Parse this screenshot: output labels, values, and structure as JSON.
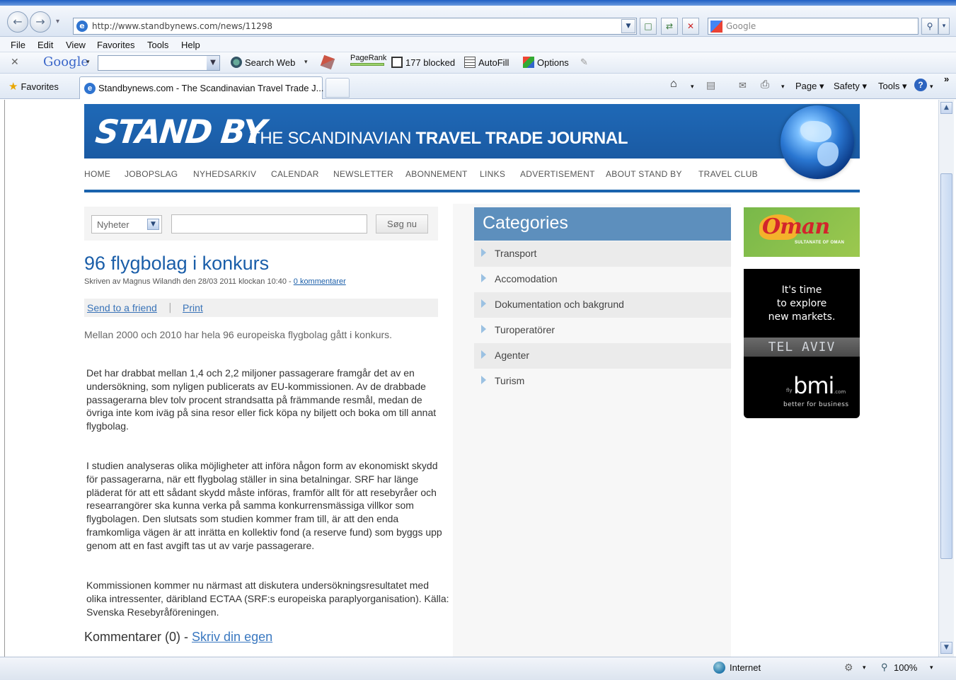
{
  "browser": {
    "url": "http://www.standbynews.com/news/11298",
    "search_placeholder": "Google",
    "menu": [
      "File",
      "Edit",
      "View",
      "Favorites",
      "Tools",
      "Help"
    ],
    "toolbar": {
      "google_logo": "Google",
      "search_web": "Search Web",
      "pagerank": "PageRank",
      "blocked": "177 blocked",
      "autofill": "AutoFill",
      "options": "Options"
    },
    "favorites_label": "Favorites",
    "tab_title": "Standbynews.com - The Scandinavian Travel Trade J...",
    "commands": {
      "page": "Page",
      "safety": "Safety",
      "tools": "Tools"
    },
    "status": {
      "zone": "Internet",
      "zoom": "100%"
    }
  },
  "site": {
    "logo": "STAND BY",
    "tagline_light": "THE SCANDINAVIAN ",
    "tagline_bold": "TRAVEL TRADE JOURNAL",
    "nav": [
      "HOME",
      "JOBOPSLAG",
      "NYHEDSARKIV",
      "CALENDAR",
      "NEWSLETTER",
      "ABONNEMENT",
      "LINKS",
      "ADVERTISEMENT",
      "ABOUT STAND BY",
      "TRAVEL CLUB"
    ]
  },
  "search": {
    "select_value": "Nyheter",
    "input_value": "",
    "button": "Søg nu"
  },
  "article": {
    "title": "96 flygbolag i konkurs",
    "byline": "Skriven av Magnus Wilandh den 28/03 2011 klockan 10:40 - ",
    "comments_link": "0 kommentarer",
    "send_to_friend": "Send to a friend",
    "separator": "|",
    "print": "Print",
    "lead": "Mellan 2000 och 2010 har hela 96 europeiska flygbolag gått i konkurs.",
    "paragraphs": [
      "Det har drabbat mellan 1,4 och 2,2 miljoner passagerare framgår det av en undersökning, som nyligen publicerats av EU-kommissionen. Av de drabbade passagerarna blev tolv procent strandsatta på främmande resmål, medan de övriga inte kom iväg på sina resor eller fick köpa ny biljett och boka om till annat flygbolag.",
      "I studien analyseras olika möjligheter att införa någon form av ekonomiskt skydd för passagerarna, när ett flygbolag ställer in sina betalningar. SRF har länge pläderat för att ett sådant skydd måste införas, framför allt för att resebyråer och researrangörer ska kunna verka på samma konkurrensmässiga villkor som flygbolagen. Den slutsats som studien kommer fram till, är att den enda framkomliga vägen är att inrätta en kollektiv fond (a reserve fund) som byggs upp genom att en fast avgift tas ut av varje passagerare.",
      "Kommissionen kommer nu närmast att diskutera undersökningsresultatet med olika intressenter, däribland ECTAA (SRF:s europeiska paraplyorganisation). Källa: Svenska Resebyråföreningen."
    ],
    "comments_label": "Kommentarer (0) - ",
    "write_own": "Skriv din egen"
  },
  "categories": {
    "title": "Categories",
    "items": [
      "Transport",
      "Accomodation",
      "Dokumentation och bakgrund",
      "Turoperatörer",
      "Agenter",
      "Turism"
    ]
  },
  "ads": {
    "oman": {
      "word": "Oman",
      "sub": "SULTANATE OF OMAN"
    },
    "bmi": {
      "line1": "It's time",
      "line2": "to explore",
      "line3": "new markets.",
      "city": "TEL AVIV",
      "fly": "fly",
      "brand": "bmi",
      "com": ".com",
      "slogan": "better for business"
    }
  },
  "colors": {
    "brand_blue": "#1a63ad",
    "category_header": "#5d8fbd",
    "link": "#1a5ea9"
  }
}
